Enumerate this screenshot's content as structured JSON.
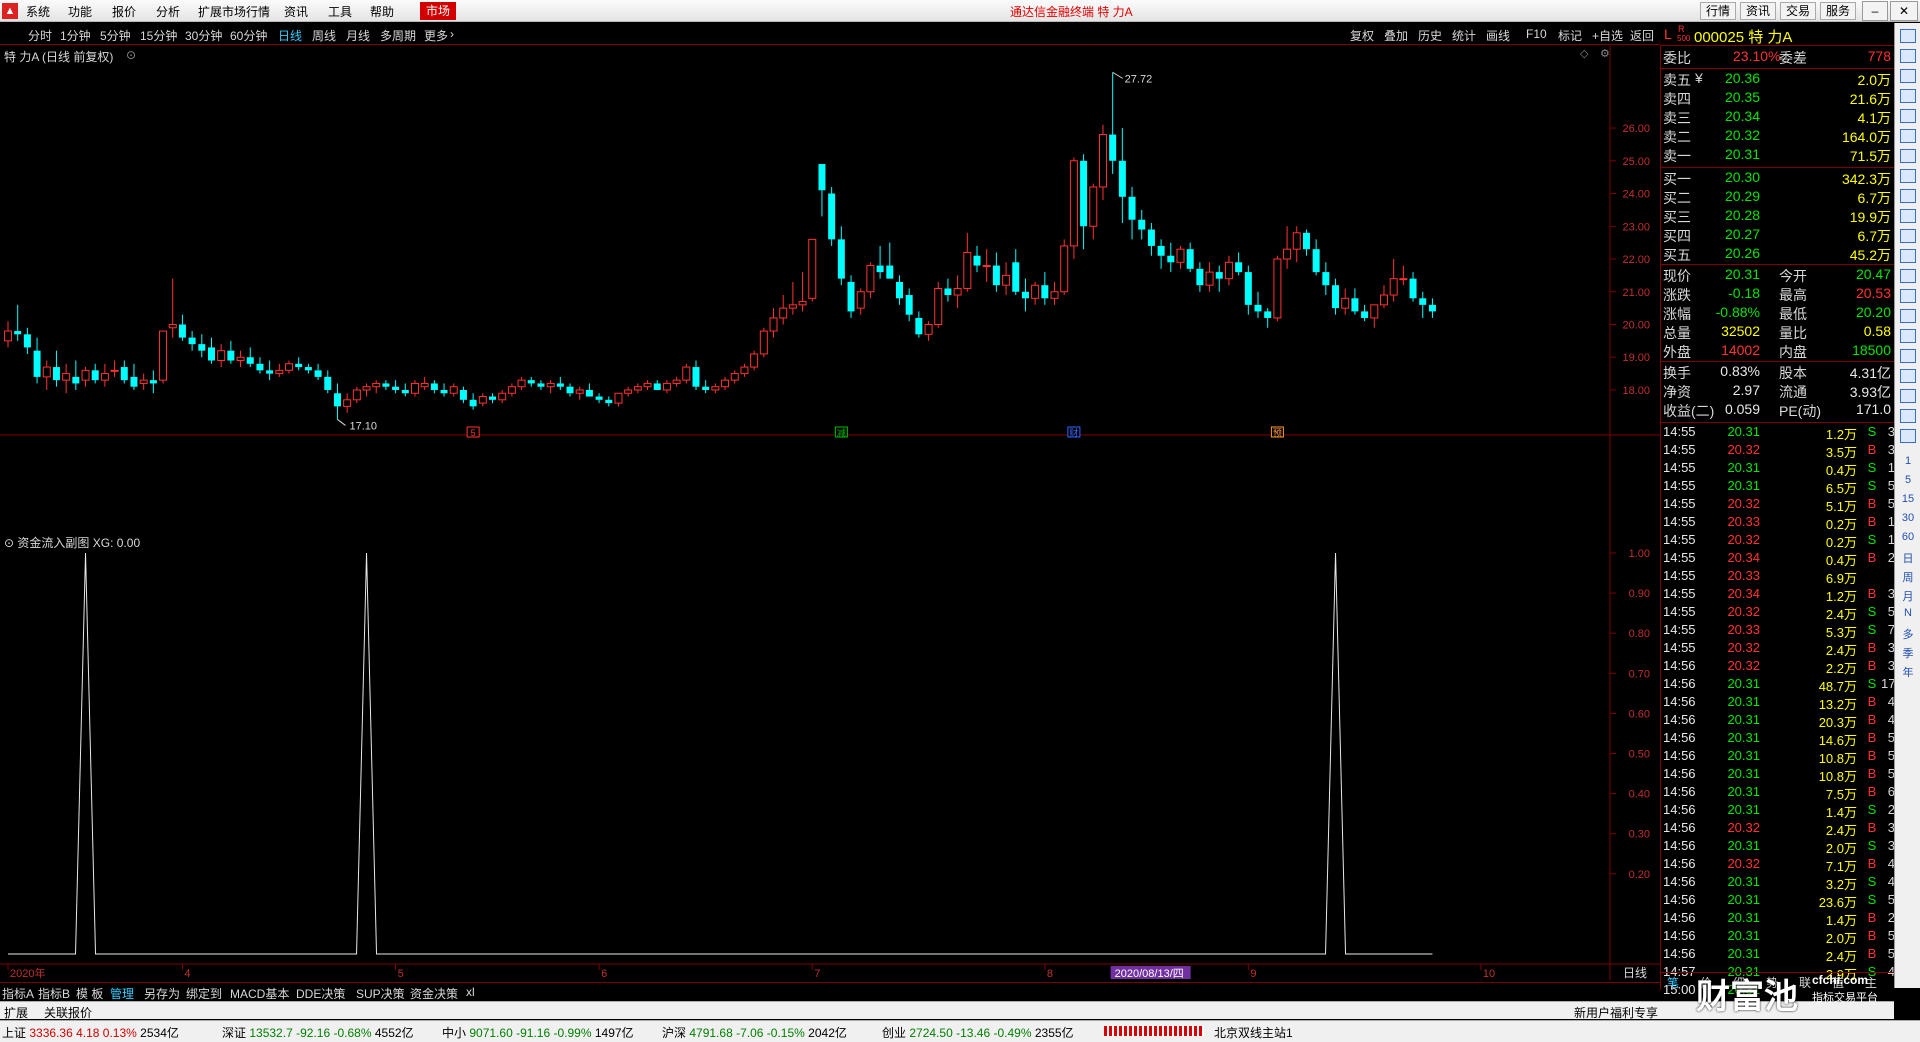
{
  "menu": {
    "items": [
      "系统",
      "功能",
      "报价",
      "分析",
      "扩展市场行情",
      "资讯",
      "工具",
      "帮助"
    ],
    "market_tab": "市场",
    "title": "通达信金融终端  特 力A",
    "top_buttons": [
      "行情",
      "资讯",
      "交易",
      "服务"
    ]
  },
  "period_bar": {
    "items": [
      "分时",
      "1分钟",
      "5分钟",
      "15分钟",
      "30分钟",
      "60分钟",
      "日线",
      "周线",
      "月线",
      "多周期",
      "更多"
    ],
    "active": "日线",
    "tools": [
      "复权",
      "叠加",
      "历史",
      "统计",
      "画线",
      "F10",
      "标记",
      "+自选",
      "返回"
    ]
  },
  "stock": {
    "code_name": "000025 特 力A",
    "l_label": "L",
    "r_label": "R",
    "sub_label": "500",
    "chart_title": "特 力A (日线 前复权)"
  },
  "chart": {
    "price_axis": [
      "26.00",
      "25.00",
      "24.00",
      "23.00",
      "22.00",
      "21.00",
      "20.00",
      "19.00",
      "18.00"
    ],
    "high_label": "27.72",
    "low_label": "17.10",
    "markers": [
      "5",
      "减",
      "财",
      "预"
    ],
    "sub_title": "资金流入副图",
    "sub_value": "XG: 0.00",
    "sub_axis": [
      "1.00",
      "0.90",
      "0.80",
      "0.70",
      "0.60",
      "0.50",
      "0.40",
      "0.30",
      "0.20"
    ],
    "date_axis": [
      "2020年",
      "4",
      "5",
      "6",
      "7",
      "8",
      "9",
      "10"
    ],
    "date_highlight": "2020/08/13/四",
    "right_bottom": "日线",
    "ohlc": [
      [
        19.5,
        20.1,
        19.3,
        19.8
      ],
      [
        19.8,
        20.6,
        19.5,
        19.7
      ],
      [
        19.7,
        19.9,
        19.1,
        19.3
      ],
      [
        19.2,
        19.6,
        18.2,
        18.4
      ],
      [
        18.4,
        18.9,
        18.0,
        18.7
      ],
      [
        18.7,
        19.2,
        18.1,
        18.3
      ],
      [
        18.3,
        18.8,
        17.9,
        18.5
      ],
      [
        18.4,
        18.9,
        18.0,
        18.2
      ],
      [
        18.3,
        18.7,
        18.1,
        18.6
      ],
      [
        18.6,
        18.8,
        18.2,
        18.3
      ],
      [
        18.3,
        18.8,
        18.1,
        18.5
      ],
      [
        18.6,
        18.9,
        18.4,
        18.6
      ],
      [
        18.7,
        18.9,
        18.2,
        18.3
      ],
      [
        18.4,
        18.8,
        18.0,
        18.1
      ],
      [
        18.2,
        18.5,
        18.0,
        18.3
      ],
      [
        18.3,
        18.6,
        17.9,
        18.2
      ],
      [
        18.3,
        19.8,
        18.2,
        19.8
      ],
      [
        19.9,
        21.4,
        19.6,
        20.0
      ],
      [
        20.0,
        20.3,
        19.5,
        19.6
      ],
      [
        19.6,
        19.8,
        19.2,
        19.4
      ],
      [
        19.4,
        19.7,
        19.0,
        19.2
      ],
      [
        19.3,
        19.6,
        18.8,
        18.9
      ],
      [
        18.9,
        19.4,
        18.7,
        19.2
      ],
      [
        19.2,
        19.5,
        18.8,
        18.9
      ],
      [
        18.9,
        19.2,
        18.7,
        19.0
      ],
      [
        19.0,
        19.3,
        18.7,
        18.8
      ],
      [
        18.8,
        19.0,
        18.5,
        18.6
      ],
      [
        18.6,
        18.9,
        18.3,
        18.5
      ],
      [
        18.5,
        18.8,
        18.4,
        18.6
      ],
      [
        18.6,
        18.9,
        18.5,
        18.8
      ],
      [
        18.8,
        19.0,
        18.6,
        18.7
      ],
      [
        18.7,
        18.8,
        18.5,
        18.6
      ],
      [
        18.6,
        18.8,
        18.3,
        18.4
      ],
      [
        18.4,
        18.6,
        17.9,
        18.0
      ],
      [
        17.9,
        18.2,
        17.1,
        17.5
      ],
      [
        17.5,
        17.9,
        17.3,
        17.7
      ],
      [
        17.7,
        18.1,
        17.6,
        18.0
      ],
      [
        18.0,
        18.2,
        17.8,
        18.1
      ],
      [
        18.1,
        18.3,
        17.9,
        18.2
      ],
      [
        18.2,
        18.3,
        18.0,
        18.1
      ],
      [
        18.1,
        18.3,
        17.9,
        18.0
      ],
      [
        18.0,
        18.2,
        17.8,
        17.9
      ],
      [
        17.9,
        18.3,
        17.8,
        18.2
      ],
      [
        18.1,
        18.4,
        18.0,
        18.2
      ],
      [
        18.2,
        18.3,
        17.9,
        18.0
      ],
      [
        18.0,
        18.2,
        17.8,
        17.9
      ],
      [
        17.9,
        18.2,
        17.8,
        18.1
      ],
      [
        18.0,
        18.1,
        17.6,
        17.7
      ],
      [
        17.7,
        17.9,
        17.4,
        17.5
      ],
      [
        17.6,
        17.9,
        17.5,
        17.8
      ],
      [
        17.8,
        17.9,
        17.6,
        17.7
      ],
      [
        17.7,
        18.0,
        17.6,
        17.9
      ],
      [
        17.9,
        18.2,
        17.8,
        18.1
      ],
      [
        18.1,
        18.4,
        18.0,
        18.3
      ],
      [
        18.3,
        18.4,
        18.1,
        18.2
      ],
      [
        18.2,
        18.3,
        18.0,
        18.1
      ],
      [
        18.1,
        18.3,
        17.9,
        18.2
      ],
      [
        18.2,
        18.4,
        18.0,
        18.1
      ],
      [
        18.1,
        18.2,
        17.8,
        17.9
      ],
      [
        17.9,
        18.1,
        17.7,
        18.0
      ],
      [
        18.0,
        18.2,
        17.8,
        17.8
      ],
      [
        17.8,
        17.9,
        17.6,
        17.7
      ],
      [
        17.7,
        17.8,
        17.5,
        17.6
      ],
      [
        17.6,
        17.9,
        17.5,
        17.9
      ],
      [
        17.9,
        18.1,
        17.8,
        18.0
      ],
      [
        18.0,
        18.2,
        17.9,
        18.1
      ],
      [
        18.1,
        18.3,
        18.0,
        18.2
      ],
      [
        18.2,
        18.3,
        18.0,
        18.0
      ],
      [
        18.0,
        18.3,
        17.9,
        18.2
      ],
      [
        18.2,
        18.4,
        18.1,
        18.3
      ],
      [
        18.3,
        18.8,
        18.2,
        18.7
      ],
      [
        18.7,
        18.9,
        18.0,
        18.1
      ],
      [
        18.1,
        18.3,
        17.9,
        18.0
      ],
      [
        18.0,
        18.2,
        17.9,
        18.1
      ],
      [
        18.1,
        18.4,
        18.0,
        18.3
      ],
      [
        18.3,
        18.6,
        18.2,
        18.5
      ],
      [
        18.5,
        18.8,
        18.4,
        18.7
      ],
      [
        18.7,
        19.2,
        18.6,
        19.1
      ],
      [
        19.1,
        19.9,
        19.0,
        19.8
      ],
      [
        19.8,
        20.5,
        19.6,
        20.2
      ],
      [
        20.2,
        20.9,
        20.0,
        20.5
      ],
      [
        20.5,
        21.3,
        20.3,
        20.6
      ],
      [
        20.6,
        21.6,
        20.4,
        20.7
      ],
      [
        20.8,
        22.6,
        20.7,
        22.6
      ],
      [
        24.9,
        24.9,
        23.3,
        24.1
      ],
      [
        24.0,
        24.2,
        22.4,
        22.6
      ],
      [
        22.6,
        23.0,
        21.2,
        21.4
      ],
      [
        21.3,
        21.5,
        20.2,
        20.4
      ],
      [
        20.5,
        21.1,
        20.3,
        21.0
      ],
      [
        21.0,
        21.9,
        20.8,
        21.8
      ],
      [
        21.8,
        22.4,
        21.4,
        21.6
      ],
      [
        21.8,
        22.5,
        21.5,
        21.4
      ],
      [
        21.3,
        21.5,
        20.6,
        20.8
      ],
      [
        20.9,
        21.1,
        20.1,
        20.3
      ],
      [
        20.2,
        20.4,
        19.6,
        19.7
      ],
      [
        19.7,
        20.1,
        19.5,
        20.0
      ],
      [
        20.0,
        21.3,
        19.9,
        21.1
      ],
      [
        21.1,
        21.4,
        20.7,
        20.9
      ],
      [
        20.9,
        21.5,
        20.5,
        21.1
      ],
      [
        21.1,
        22.8,
        21.0,
        22.2
      ],
      [
        22.1,
        22.4,
        21.6,
        21.8
      ],
      [
        21.8,
        22.3,
        21.3,
        21.8
      ],
      [
        21.8,
        22.2,
        21.0,
        21.2
      ],
      [
        21.2,
        21.9,
        20.9,
        21.5
      ],
      [
        21.9,
        22.3,
        20.9,
        21.0
      ],
      [
        21.0,
        21.4,
        20.4,
        20.8
      ],
      [
        20.8,
        21.3,
        20.6,
        21.2
      ],
      [
        21.2,
        21.6,
        20.6,
        20.8
      ],
      [
        20.8,
        21.3,
        20.6,
        21.0
      ],
      [
        21.0,
        22.6,
        20.9,
        22.4
      ],
      [
        22.4,
        25.1,
        22.0,
        25.0
      ],
      [
        25.0,
        25.2,
        22.3,
        23.0
      ],
      [
        23.0,
        24.3,
        22.6,
        24.2
      ],
      [
        24.2,
        26.1,
        23.8,
        25.8
      ],
      [
        25.8,
        27.7,
        24.6,
        25.0
      ],
      [
        25.0,
        26.0,
        23.1,
        23.9
      ],
      [
        23.9,
        24.2,
        22.6,
        23.2
      ],
      [
        23.2,
        23.5,
        22.6,
        22.9
      ],
      [
        22.9,
        23.1,
        22.1,
        22.4
      ],
      [
        22.4,
        22.6,
        21.7,
        22.1
      ],
      [
        22.1,
        22.5,
        21.6,
        21.9
      ],
      [
        21.9,
        22.4,
        21.7,
        22.3
      ],
      [
        22.3,
        22.5,
        21.6,
        21.7
      ],
      [
        21.7,
        21.9,
        21.0,
        21.2
      ],
      [
        21.2,
        21.9,
        21.0,
        21.6
      ],
      [
        21.6,
        21.8,
        21.0,
        21.4
      ],
      [
        21.4,
        22.1,
        21.2,
        21.9
      ],
      [
        21.9,
        22.2,
        21.5,
        21.6
      ],
      [
        21.6,
        21.8,
        20.3,
        20.6
      ],
      [
        20.6,
        21.0,
        20.2,
        20.4
      ],
      [
        20.4,
        20.5,
        19.9,
        20.2
      ],
      [
        20.2,
        22.1,
        20.1,
        22.0
      ],
      [
        22.0,
        23.0,
        21.7,
        22.3
      ],
      [
        22.3,
        23.0,
        21.9,
        22.8
      ],
      [
        22.8,
        22.9,
        22.1,
        22.3
      ],
      [
        22.3,
        22.6,
        21.5,
        21.6
      ],
      [
        21.6,
        21.9,
        20.9,
        21.2
      ],
      [
        21.2,
        21.4,
        20.3,
        20.5
      ],
      [
        20.5,
        21.1,
        20.3,
        20.8
      ],
      [
        20.8,
        21.1,
        20.3,
        20.4
      ],
      [
        20.4,
        20.6,
        20.1,
        20.2
      ],
      [
        20.2,
        20.5,
        19.9,
        20.6
      ],
      [
        20.6,
        21.2,
        20.5,
        20.9
      ],
      [
        20.9,
        22.0,
        20.7,
        21.4
      ],
      [
        21.4,
        21.8,
        21.2,
        21.4
      ],
      [
        21.4,
        21.6,
        20.7,
        20.8
      ],
      [
        20.8,
        21.0,
        20.2,
        20.6
      ],
      [
        20.6,
        20.8,
        20.2,
        20.4
      ]
    ],
    "spikes": [
      8,
      37,
      137
    ]
  },
  "quote": {
    "weibi_label": "委比",
    "weibi": "23.10%",
    "weicha_label": "委差",
    "weicha": "778",
    "asks": [
      {
        "label": "卖五",
        "flag": "¥",
        "price": "20.36",
        "vol": "2.0万"
      },
      {
        "label": "卖四",
        "flag": "",
        "price": "20.35",
        "vol": "21.6万"
      },
      {
        "label": "卖三",
        "flag": "",
        "price": "20.34",
        "vol": "4.1万"
      },
      {
        "label": "卖二",
        "flag": "",
        "price": "20.32",
        "vol": "164.0万"
      },
      {
        "label": "卖一",
        "flag": "",
        "price": "20.31",
        "vol": "71.5万"
      }
    ],
    "bids": [
      {
        "label": "买一",
        "price": "20.30",
        "vol": "342.3万"
      },
      {
        "label": "买二",
        "price": "20.29",
        "vol": "6.7万"
      },
      {
        "label": "买三",
        "price": "20.28",
        "vol": "19.9万"
      },
      {
        "label": "买四",
        "price": "20.27",
        "vol": "6.7万"
      },
      {
        "label": "买五",
        "price": "20.26",
        "vol": "45.2万"
      }
    ],
    "stats": [
      {
        "l1": "现价",
        "v1": "20.31",
        "c1": "green",
        "l2": "今开",
        "v2": "20.47",
        "c2": "green"
      },
      {
        "l1": "涨跌",
        "v1": "-0.18",
        "c1": "green",
        "l2": "最高",
        "v2": "20.53",
        "c2": "red"
      },
      {
        "l1": "涨幅",
        "v1": "-0.88%",
        "c1": "green",
        "l2": "最低",
        "v2": "20.20",
        "c2": "green"
      },
      {
        "l1": "总量",
        "v1": "32502",
        "c1": "yellow",
        "l2": "量比",
        "v2": "0.58",
        "c2": "yellow"
      },
      {
        "l1": "外盘",
        "v1": "14002",
        "c1": "red",
        "l2": "内盘",
        "v2": "18500",
        "c2": "green"
      }
    ],
    "stats2": [
      {
        "l1": "换手",
        "v1": "0.83%",
        "l2": "股本",
        "v2": "4.31亿"
      },
      {
        "l1": "净资",
        "v1": "2.97",
        "l2": "流通",
        "v2": "3.93亿"
      },
      {
        "l1": "收益(二)",
        "v1": "0.059",
        "l2": "PE(动)",
        "v2": "171.0"
      }
    ]
  },
  "ticks": [
    [
      "14:55",
      "20.31",
      "1.2万",
      "S",
      "3"
    ],
    [
      "14:55",
      "20.32",
      "3.5万",
      "B",
      "3"
    ],
    [
      "14:55",
      "20.31",
      "0.4万",
      "S",
      "1"
    ],
    [
      "14:55",
      "20.31",
      "6.5万",
      "S",
      "5"
    ],
    [
      "14:55",
      "20.32",
      "5.1万",
      "B",
      "5"
    ],
    [
      "14:55",
      "20.33",
      "0.2万",
      "B",
      "1"
    ],
    [
      "14:55",
      "20.32",
      "0.2万",
      "S",
      "1"
    ],
    [
      "14:55",
      "20.34",
      "0.4万",
      "B",
      "2"
    ],
    [
      "14:55",
      "20.33",
      "6.9万",
      "",
      ""
    ],
    [
      "14:55",
      "20.34",
      "1.2万",
      "B",
      "3"
    ],
    [
      "14:55",
      "20.32",
      "2.4万",
      "S",
      "5"
    ],
    [
      "14:55",
      "20.33",
      "5.3万",
      "S",
      "7"
    ],
    [
      "14:55",
      "20.32",
      "2.4万",
      "B",
      "3"
    ],
    [
      "14:56",
      "20.32",
      "2.2万",
      "B",
      "3"
    ],
    [
      "14:56",
      "20.31",
      "48.7万",
      "S",
      "17"
    ],
    [
      "14:56",
      "20.31",
      "13.2万",
      "B",
      "4"
    ],
    [
      "14:56",
      "20.31",
      "20.3万",
      "B",
      "4"
    ],
    [
      "14:56",
      "20.31",
      "14.6万",
      "B",
      "5"
    ],
    [
      "14:56",
      "20.31",
      "10.8万",
      "B",
      "5"
    ],
    [
      "14:56",
      "20.31",
      "10.8万",
      "B",
      "5"
    ],
    [
      "14:56",
      "20.31",
      "7.5万",
      "B",
      "6"
    ],
    [
      "14:56",
      "20.31",
      "1.4万",
      "S",
      "2"
    ],
    [
      "14:56",
      "20.32",
      "2.4万",
      "B",
      "3"
    ],
    [
      "14:56",
      "20.31",
      "2.0万",
      "S",
      "3"
    ],
    [
      "14:56",
      "20.32",
      "7.1万",
      "B",
      "4"
    ],
    [
      "14:56",
      "20.31",
      "3.2万",
      "S",
      "4"
    ],
    [
      "14:56",
      "20.31",
      "23.6万",
      "S",
      "5"
    ],
    [
      "14:56",
      "20.31",
      "1.4万",
      "B",
      "2"
    ],
    [
      "14:56",
      "20.31",
      "2.0万",
      "B",
      "5"
    ],
    [
      "14:56",
      "20.31",
      "2.4万",
      "B",
      "5"
    ],
    [
      "14:57",
      "20.31",
      "2.9万",
      "S",
      "4"
    ],
    [
      "15:00",
      "20.31",
      "",
      ""
    ]
  ],
  "tick_tabs": [
    "笔",
    "价",
    "细",
    "势",
    "联",
    "值",
    "主"
  ],
  "bottom_tabs": [
    "指标A",
    "指标B",
    "模 板",
    "管理",
    "另存为",
    "绑定到",
    "MACD基本",
    "DDE决策",
    "SUP决策",
    "资金决策",
    "xl"
  ],
  "bottom_active": "管理",
  "bottom2": {
    "left": [
      "扩展",
      "关联报价"
    ],
    "right": "新用户福利专享"
  },
  "status": [
    {
      "name": "上证",
      "val": "3336.36",
      "chg": "4.18",
      "pct": "0.13%",
      "amt": "2534亿",
      "dir": "up"
    },
    {
      "name": "深证",
      "val": "13532.7",
      "chg": "-92.16",
      "pct": "-0.68%",
      "amt": "4552亿",
      "dir": "down"
    },
    {
      "name": "中小",
      "val": "9071.60",
      "chg": "-91.16",
      "pct": "-0.99%",
      "amt": "1497亿",
      "dir": "down"
    },
    {
      "name": "沪深",
      "val": "4791.68",
      "chg": "-7.06",
      "pct": "-0.15%",
      "amt": "2042亿",
      "dir": "down"
    },
    {
      "name": "创业",
      "val": "2724.50",
      "chg": "-13.46",
      "pct": "-0.49%",
      "amt": "2355亿",
      "dir": "down"
    }
  ],
  "server": "北京双线主站1",
  "watermark": {
    "main": "财富池",
    "sub": "cfchi.com",
    "sub2": "指标交易平台"
  },
  "side_labels": [
    "1",
    "5",
    "15",
    "30",
    "60",
    "日",
    "周",
    "月",
    "N",
    "多",
    "季",
    "年"
  ],
  "colors": {
    "up": "#ff3232",
    "down": "#00ffff",
    "frame": "#800000",
    "grid": "#3a0000"
  }
}
